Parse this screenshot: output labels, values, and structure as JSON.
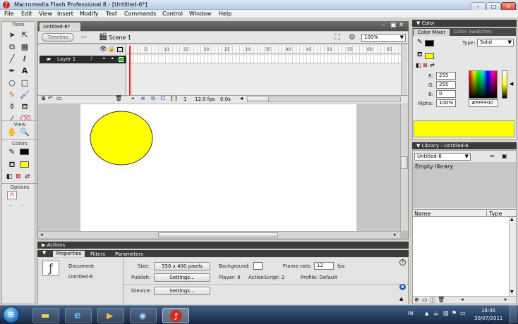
{
  "window": {
    "title": "Macromedia Flash Professional 8 - [Untitled-6*]",
    "controls": [
      "–",
      "□",
      "✕"
    ]
  },
  "menu": [
    "File",
    "Edit",
    "View",
    "Insert",
    "Modify",
    "Text",
    "Commands",
    "Control",
    "Window",
    "Help"
  ],
  "document": {
    "tab": "Untitled-6*",
    "timeline_button": "Timeline",
    "scene": "Scene 1",
    "zoom": "100%",
    "doc_controls": [
      "–",
      "▣",
      "✕"
    ]
  },
  "toolbox": {
    "header": "Tools",
    "view_label": "View",
    "colors_label": "Colors",
    "options_label": "Options"
  },
  "timeline": {
    "layer_name": "Layer 1",
    "ruler": [
      "5",
      "10",
      "15",
      "20",
      "25",
      "30",
      "35",
      "40",
      "45",
      "50",
      "55",
      "60",
      "65"
    ],
    "current_frame": "1",
    "frame_rate": "12.0 fps",
    "elapsed": "0.0s"
  },
  "stage": {
    "shape": "ellipse",
    "fill": "#ffff00",
    "stroke": "#333333",
    "background": "#ffffff"
  },
  "actions_panel": {
    "title": "Actions"
  },
  "properties": {
    "tabs": [
      "Properties",
      "Filters",
      "Parameters"
    ],
    "doc_type": "Document",
    "doc_name": "Untitled-6",
    "size_label": "Size:",
    "size_value": "550 x 400 pixels",
    "background_label": "Background:",
    "frame_rate_label": "Frame rate:",
    "frame_rate_value": "12",
    "fps_label": "fps",
    "publish_label": "Publish:",
    "settings_label": "Settings...",
    "player_label": "Player: 8",
    "actionscript_label": "ActionScript: 2",
    "profile_label": "Profile: Default",
    "idevice_label": "iDevice:",
    "idevice_settings": "Settings..."
  },
  "color_panel": {
    "header": "Color",
    "tabs": [
      "Color Mixer",
      "Color Swatches"
    ],
    "type_label": "Type:",
    "type_value": "Solid",
    "r_label": "R:",
    "r_value": "255",
    "g_label": "G:",
    "g_value": "255",
    "b_label": "B:",
    "b_value": "0",
    "alpha_label": "Alpha:",
    "alpha_value": "100%",
    "hex_value": "#FFFF00",
    "current_color": "#ffff00"
  },
  "library_panel": {
    "header": "Library - Untitled-6",
    "doc_select": "Untitled-6",
    "empty_text": "Empty library",
    "col_name": "Name",
    "col_type": "Type"
  },
  "taskbar": {
    "lang": "IN",
    "time": "16:45",
    "date": "30/07/2011"
  }
}
